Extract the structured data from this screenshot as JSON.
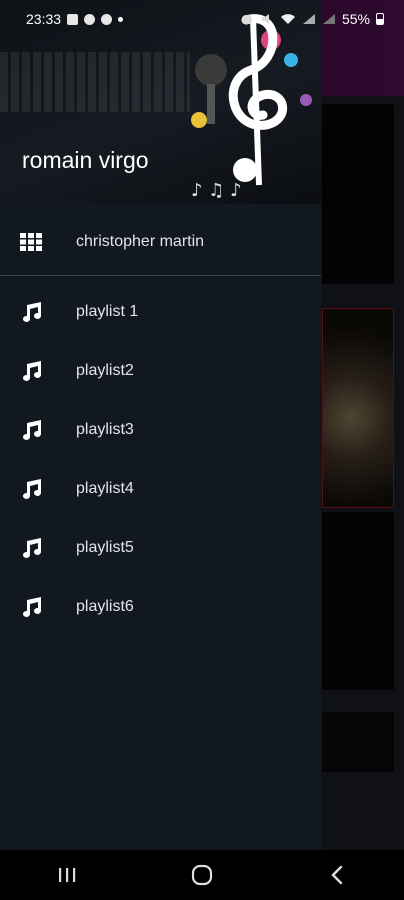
{
  "status_bar": {
    "time": "23:33",
    "battery": "55%"
  },
  "drawer": {
    "header": {
      "username": "romain virgo"
    },
    "top_item": {
      "label": "christopher martin",
      "icon": "grid-icon"
    },
    "playlists": [
      {
        "label": "playlist 1",
        "icon": "music-note-icon"
      },
      {
        "label": "playlist2",
        "icon": "music-note-icon"
      },
      {
        "label": "playlist3",
        "icon": "music-note-icon"
      },
      {
        "label": "playlist4",
        "icon": "music-note-icon"
      },
      {
        "label": "playlist5",
        "icon": "music-note-icon"
      },
      {
        "label": "playlist6",
        "icon": "music-note-icon"
      }
    ]
  },
  "nav_bar": {
    "buttons": [
      "recent-apps-icon",
      "home-icon",
      "back-icon"
    ]
  },
  "colors": {
    "drawer_bg": "#121820",
    "toolbar_accent": "#4a0f4a",
    "text": "#e2e5ea"
  }
}
